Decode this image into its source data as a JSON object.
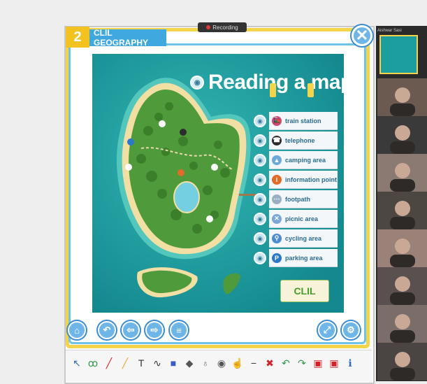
{
  "lesson": {
    "number": "2",
    "title": "CLIL GEOGRAPHY",
    "close": "✕"
  },
  "recording_label": "Recording",
  "map": {
    "title": "Reading a map",
    "legend": [
      {
        "label": "train station",
        "icon": "train-icon",
        "color": "#d0467a",
        "glyph": "🚂"
      },
      {
        "label": "telephone",
        "icon": "telephone-icon",
        "color": "#2c2c2c",
        "glyph": "☎"
      },
      {
        "label": "camping area",
        "icon": "tent-icon",
        "color": "#6aa9d8",
        "glyph": "▲"
      },
      {
        "label": "information point",
        "icon": "info-icon",
        "color": "#e06b2a",
        "glyph": "i"
      },
      {
        "label": "footpath",
        "icon": "footpath-icon",
        "color": "#9ab0c2",
        "glyph": "⋯"
      },
      {
        "label": "picnic area",
        "icon": "picnic-icon",
        "color": "#7aa7d6",
        "glyph": "✕"
      },
      {
        "label": "cycling area",
        "icon": "bicycle-icon",
        "color": "#4b8bd0",
        "glyph": "⚲"
      },
      {
        "label": "parking area",
        "icon": "parking-icon",
        "color": "#2a78c9",
        "glyph": "P"
      }
    ],
    "logo": "CLIL"
  },
  "nav": {
    "home": "⌂",
    "back": "↶",
    "prev": "⇦",
    "next": "⇨",
    "menu": "≡",
    "fit": "⤢",
    "settings": "⚙"
  },
  "toolbar": [
    {
      "name": "cursor-tool",
      "glyph": "↖",
      "color": "#2f6db5"
    },
    {
      "name": "lasso-tool",
      "glyph": "ꝏ",
      "color": "#2e9a4a"
    },
    {
      "name": "pen-tool",
      "glyph": "╱",
      "color": "#d2232a"
    },
    {
      "name": "highlighter-tool",
      "glyph": "╱",
      "color": "#f0a629"
    },
    {
      "name": "text-tool",
      "glyph": "T",
      "color": "#333333"
    },
    {
      "name": "curve-tool",
      "glyph": "∿",
      "color": "#333333"
    },
    {
      "name": "shape-tool",
      "glyph": "■",
      "color": "#3a5bc7"
    },
    {
      "name": "eraser-tool",
      "glyph": "◆",
      "color": "#555555"
    },
    {
      "name": "spotlight-tool",
      "glyph": "♁",
      "color": "#777777"
    },
    {
      "name": "camera-tool",
      "glyph": "◉",
      "color": "#555555"
    },
    {
      "name": "hand-tool",
      "glyph": "☝",
      "color": "#333333"
    },
    {
      "name": "minus-tool",
      "glyph": "−",
      "color": "#333333"
    },
    {
      "name": "clear-tool",
      "glyph": "✖",
      "color": "#d2232a"
    },
    {
      "name": "undo-tool",
      "glyph": "↶",
      "color": "#2e9a4a"
    },
    {
      "name": "redo-tool",
      "glyph": "↷",
      "color": "#2e9a4a"
    },
    {
      "name": "save-tool",
      "glyph": "▣",
      "color": "#d2232a"
    },
    {
      "name": "open-tool",
      "glyph": "▣",
      "color": "#d2232a"
    },
    {
      "name": "info-tool",
      "glyph": "ℹ",
      "color": "#2f6db5"
    }
  ],
  "meeting": {
    "presenter_label": "Aishwar Sasi",
    "participants": [
      {
        "name": "participant-1",
        "bg": "#6b5a4f"
      },
      {
        "name": "participant-2",
        "bg": "#3a3a3a"
      },
      {
        "name": "participant-3",
        "bg": "#8a7a72"
      },
      {
        "name": "participant-4",
        "bg": "#4d4741"
      },
      {
        "name": "participant-5",
        "bg": "#9a8278"
      },
      {
        "name": "participant-6",
        "bg": "#5a5050"
      },
      {
        "name": "participant-7",
        "bg": "#7b6e68"
      },
      {
        "name": "participant-8",
        "bg": "#4a4442"
      }
    ]
  }
}
